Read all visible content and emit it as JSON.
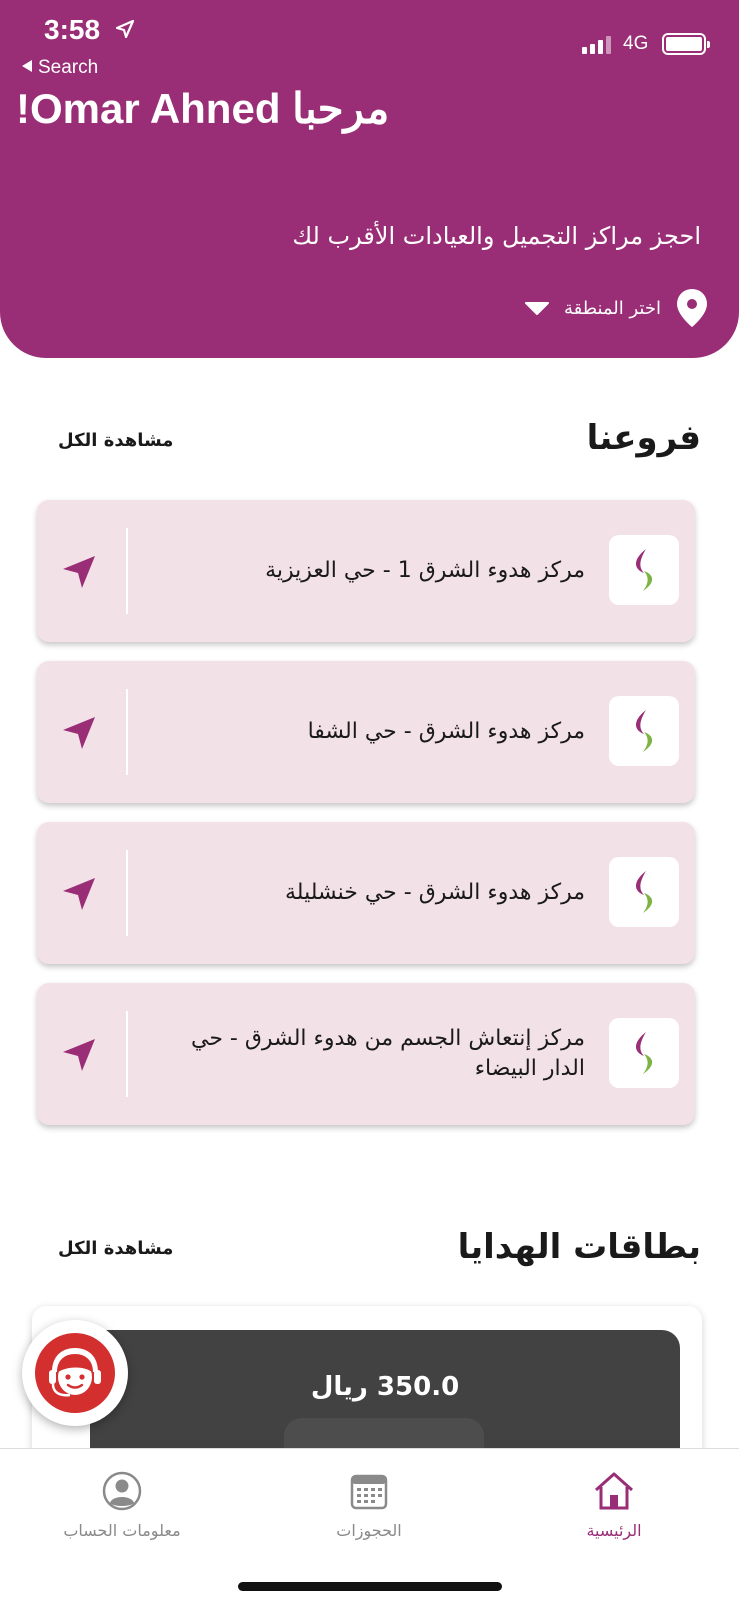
{
  "status_bar": {
    "time": "3:58",
    "back_label": "Search",
    "network": "4G"
  },
  "header": {
    "greeting": "!Omar Ahned  مرحبا",
    "subtitle": "احجز مراكز التجميل والعيادات الأقرب لك",
    "region_label": "اختر المنطقة"
  },
  "branches_section": {
    "title": "فروعنا",
    "see_all": "مشاهدة الكل",
    "items": [
      {
        "name": "مركز هدوء الشرق 1 - حي العزيزية"
      },
      {
        "name": "مركز هدوء الشرق - حي الشفا"
      },
      {
        "name": "مركز هدوء الشرق - حي خنشليلة"
      },
      {
        "name": "مركز إنتعاش الجسم من هدوء الشرق - حي الدار البيضاء"
      }
    ]
  },
  "gift_section": {
    "title": "بطاقات الهدايا",
    "see_all": "مشاهدة الكل",
    "card_amount": "350.0 ريال"
  },
  "tab_bar": {
    "tabs": [
      {
        "label": "الرئيسية",
        "icon": "home-icon",
        "active": true
      },
      {
        "label": "الحجوزات",
        "icon": "calendar-icon",
        "active": false
      },
      {
        "label": "معلومات الحساب",
        "icon": "user-icon",
        "active": false
      }
    ]
  },
  "colors": {
    "brand": "#992e76",
    "card_bg": "#f3e1e8",
    "gift_card": "#424242",
    "inactive_tab": "#8a8a8a"
  }
}
